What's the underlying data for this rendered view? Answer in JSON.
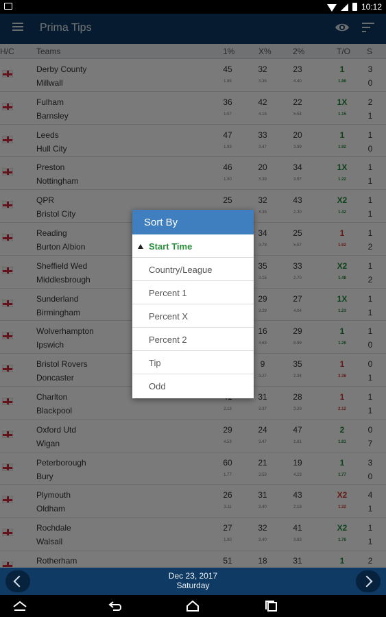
{
  "status": {
    "time": "10:12"
  },
  "app": {
    "title": "Prima Tips"
  },
  "table": {
    "headers": {
      "hc": "H/C",
      "teams": "Teams",
      "p1": "1%",
      "px": "X%",
      "p2": "2%",
      "to": "T/O",
      "s": "S"
    },
    "rows": [
      {
        "home": "Derby County",
        "away": "Millwall",
        "p1": "45",
        "px": "32",
        "p2": "23",
        "o1": "1.86",
        "ox": "3.36",
        "o2": "4.40",
        "tip": "1",
        "tip_color": "green",
        "odd": "1.86",
        "s1": "3",
        "s2": "0"
      },
      {
        "home": "Fulham",
        "away": "Barnsley",
        "p1": "36",
        "px": "42",
        "p2": "22",
        "o1": "1.57",
        "ox": "4.16",
        "o2": "5.54",
        "tip": "1X",
        "tip_color": "green",
        "odd": "1.15",
        "s1": "2",
        "s2": "1"
      },
      {
        "home": "Leeds",
        "away": "Hull City",
        "p1": "47",
        "px": "33",
        "p2": "20",
        "o1": "1.93",
        "ox": "3.47",
        "o2": "3.99",
        "tip": "1",
        "tip_color": "green",
        "odd": "1.92",
        "s1": "1",
        "s2": "0"
      },
      {
        "home": "Preston",
        "away": "Nottingham",
        "p1": "46",
        "px": "20",
        "p2": "34",
        "o1": "1.90",
        "ox": "3.39",
        "o2": "3.97",
        "tip": "1X",
        "tip_color": "green",
        "odd": "1.22",
        "s1": "1",
        "s2": "1"
      },
      {
        "home": "QPR",
        "away": "Bristol City",
        "p1": "25",
        "px": "32",
        "p2": "43",
        "o1": "",
        "ox": "3.36",
        "o2": "2.30",
        "tip": "X2",
        "tip_color": "green",
        "odd": "1.42",
        "s1": "1",
        "s2": "1"
      },
      {
        "home": "Reading",
        "away": "Burton Albion",
        "p1": "",
        "px": "34",
        "p2": "25",
        "o1": "",
        "ox": "3.78",
        "o2": "5.57",
        "tip": "1",
        "tip_color": "red",
        "odd": "1.62",
        "s1": "1",
        "s2": "2"
      },
      {
        "home": "Sheffield Wed",
        "away": "Middlesbrough",
        "p1": "",
        "px": "35",
        "p2": "33",
        "o1": "",
        "ox": "3.15",
        "o2": "2.70",
        "tip": "X2",
        "tip_color": "green",
        "odd": "1.48",
        "s1": "1",
        "s2": "2"
      },
      {
        "home": "Sunderland",
        "away": "Birmingham",
        "p1": "",
        "px": "29",
        "p2": "27",
        "o1": "",
        "ox": "3.28",
        "o2": "4.04",
        "tip": "1X",
        "tip_color": "green",
        "odd": "1.23",
        "s1": "1",
        "s2": "1"
      },
      {
        "home": "Wolverhampton",
        "away": "Ipswich",
        "p1": "",
        "px": "16",
        "p2": "29",
        "o1": "",
        "ox": "4.63",
        "o2": "8.99",
        "tip": "1",
        "tip_color": "green",
        "odd": "1.26",
        "s1": "1",
        "s2": "0"
      },
      {
        "home": "Bristol Rovers",
        "away": "Doncaster",
        "p1": "",
        "px": "9",
        "p2": "35",
        "o1": "",
        "ox": "3.27",
        "o2": "2.34",
        "tip": "1",
        "tip_color": "red",
        "odd": "3.38",
        "s1": "0",
        "s2": "1"
      },
      {
        "home": "Charlton",
        "away": "Blackpool",
        "p1": "41",
        "px": "31",
        "p2": "28",
        "o1": "2.13",
        "ox": "3.37",
        "o2": "3.29",
        "tip": "1",
        "tip_color": "red",
        "odd": "2.12",
        "s1": "1",
        "s2": "1"
      },
      {
        "home": "Oxford Utd",
        "away": "Wigan",
        "p1": "29",
        "px": "24",
        "p2": "47",
        "o1": "4.53",
        "ox": "3.47",
        "o2": "1.81",
        "tip": "2",
        "tip_color": "green",
        "odd": "1.81",
        "s1": "0",
        "s2": "7"
      },
      {
        "home": "Peterborough",
        "away": "Bury",
        "p1": "60",
        "px": "21",
        "p2": "19",
        "o1": "1.77",
        "ox": "3.58",
        "o2": "4.23",
        "tip": "1",
        "tip_color": "green",
        "odd": "1.77",
        "s1": "3",
        "s2": "0"
      },
      {
        "home": "Plymouth",
        "away": "Oldham",
        "p1": "26",
        "px": "31",
        "p2": "43",
        "o1": "3.11",
        "ox": "3.40",
        "o2": "2.19",
        "tip": "X2",
        "tip_color": "red",
        "odd": "1.32",
        "s1": "4",
        "s2": "1"
      },
      {
        "home": "Rochdale",
        "away": "Walsall",
        "p1": "27",
        "px": "32",
        "p2": "41",
        "o1": "1.90",
        "ox": "3.40",
        "o2": "3.83",
        "tip": "X2",
        "tip_color": "green",
        "odd": "1.78",
        "s1": "1",
        "s2": "1"
      },
      {
        "home": "Rotherham",
        "away": "",
        "p1": "51",
        "px": "18",
        "p2": "31",
        "o1": "",
        "ox": "",
        "o2": "",
        "tip": "1",
        "tip_color": "green",
        "odd": "",
        "s1": "2",
        "s2": ""
      }
    ]
  },
  "footer": {
    "date": "Dec 23, 2017",
    "day": "Saturday"
  },
  "dialog": {
    "title": "Sort By",
    "options": [
      "Start Time",
      "Country/League",
      "Percent 1",
      "Percent X",
      "Percent 2",
      "Tip",
      "Odd"
    ],
    "selected": "Start Time"
  },
  "icons": [
    "menu-icon",
    "eye-icon",
    "sort-icon",
    "back-arrow-icon",
    "forward-arrow-icon",
    "home-icon",
    "recents-icon",
    "up-nav-icon"
  ]
}
